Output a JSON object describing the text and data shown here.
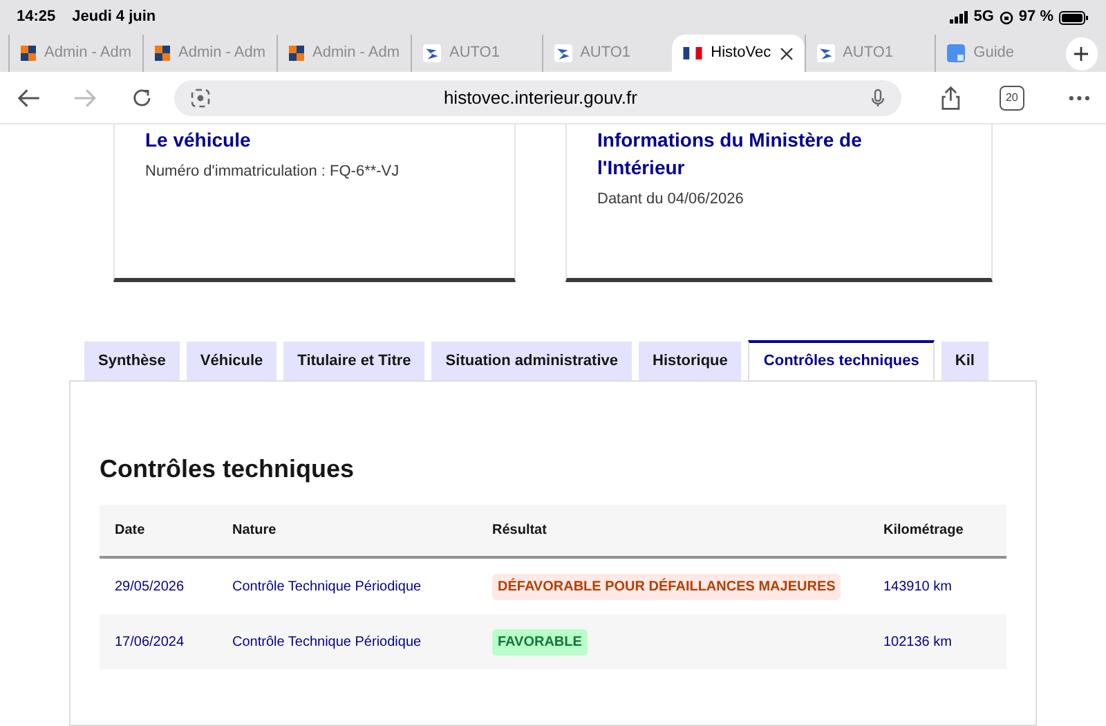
{
  "status_bar": {
    "time": "14:25",
    "date": "Jeudi 4 juin",
    "network": "5G",
    "battery": "97 %"
  },
  "browser_tabs": [
    {
      "label": "Admin - Adm",
      "kind": "admin",
      "selected": false
    },
    {
      "label": "Admin - Adm",
      "kind": "admin",
      "selected": false
    },
    {
      "label": "Admin - Adm",
      "kind": "admin",
      "selected": false
    },
    {
      "label": "AUTO1",
      "kind": "auto",
      "selected": false
    },
    {
      "label": "AUTO1",
      "kind": "auto",
      "selected": false
    },
    {
      "label": "HistoVec",
      "kind": "flag",
      "selected": true
    },
    {
      "label": "AUTO1",
      "kind": "auto",
      "selected": false
    },
    {
      "label": "Guide",
      "kind": "guide",
      "selected": false
    }
  ],
  "address_bar": {
    "url": "histovec.interieur.gouv.fr",
    "tab_count": "20"
  },
  "cards": [
    {
      "title": "Le véhicule",
      "text": "Numéro d'immatriculation : FQ-6**-VJ"
    },
    {
      "title": "Informations du Ministère de l'Intérieur",
      "text": "Datant du 04/06/2026"
    }
  ],
  "tabs": [
    {
      "label": "Synthèse",
      "selected": false
    },
    {
      "label": "Véhicule",
      "selected": false
    },
    {
      "label": "Titulaire et Titre",
      "selected": false
    },
    {
      "label": "Situation administrative",
      "selected": false
    },
    {
      "label": "Historique",
      "selected": false
    },
    {
      "label": "Contrôles techniques",
      "selected": true
    },
    {
      "label": "Kil",
      "selected": false
    }
  ],
  "section_title": "Contrôles techniques",
  "table": {
    "columns": [
      "Date",
      "Nature",
      "Résultat",
      "Kilométrage"
    ],
    "rows": [
      {
        "date": "29/05/2026",
        "nature": "Contrôle Technique Périodique",
        "result": "DÉFAVORABLE POUR DÉFAILLANCES MAJEURES",
        "kind": "unfavorable",
        "mileage": "143910 km"
      },
      {
        "date": "17/06/2024",
        "nature": "Contrôle Technique Périodique",
        "result": "FAVORABLE",
        "kind": "favorable",
        "mileage": "102136 km"
      }
    ]
  }
}
